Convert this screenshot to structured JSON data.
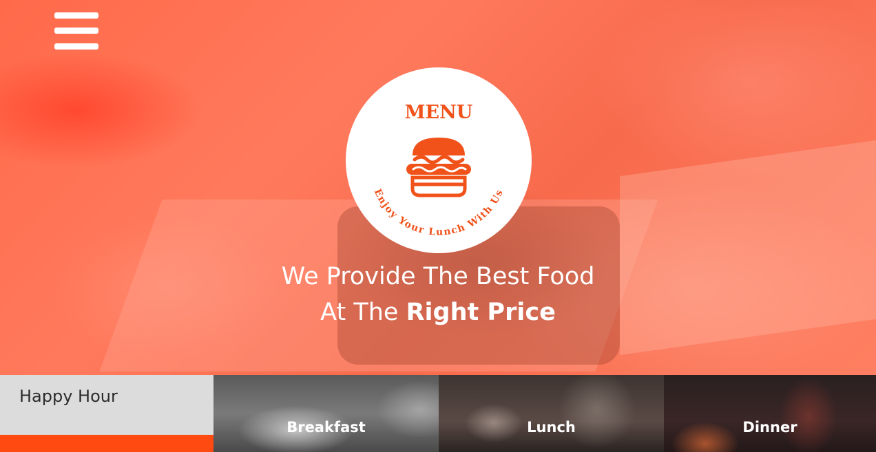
{
  "nav": {
    "menu_icon": "hamburger-menu-icon"
  },
  "badge": {
    "title": "MENU",
    "tagline": "Enjoy Your Lunch With Us",
    "icon": "burger-icon",
    "accent": "#f0521a"
  },
  "headline": {
    "line1": "We Provide The Best Food",
    "line2_prefix": "At The",
    "line2_strong": "Right Price"
  },
  "strip": {
    "happy_hour": "Happy Hour",
    "tiles": [
      "Breakfast",
      "Lunch",
      "Dinner"
    ],
    "accent": "#ff4a12"
  }
}
